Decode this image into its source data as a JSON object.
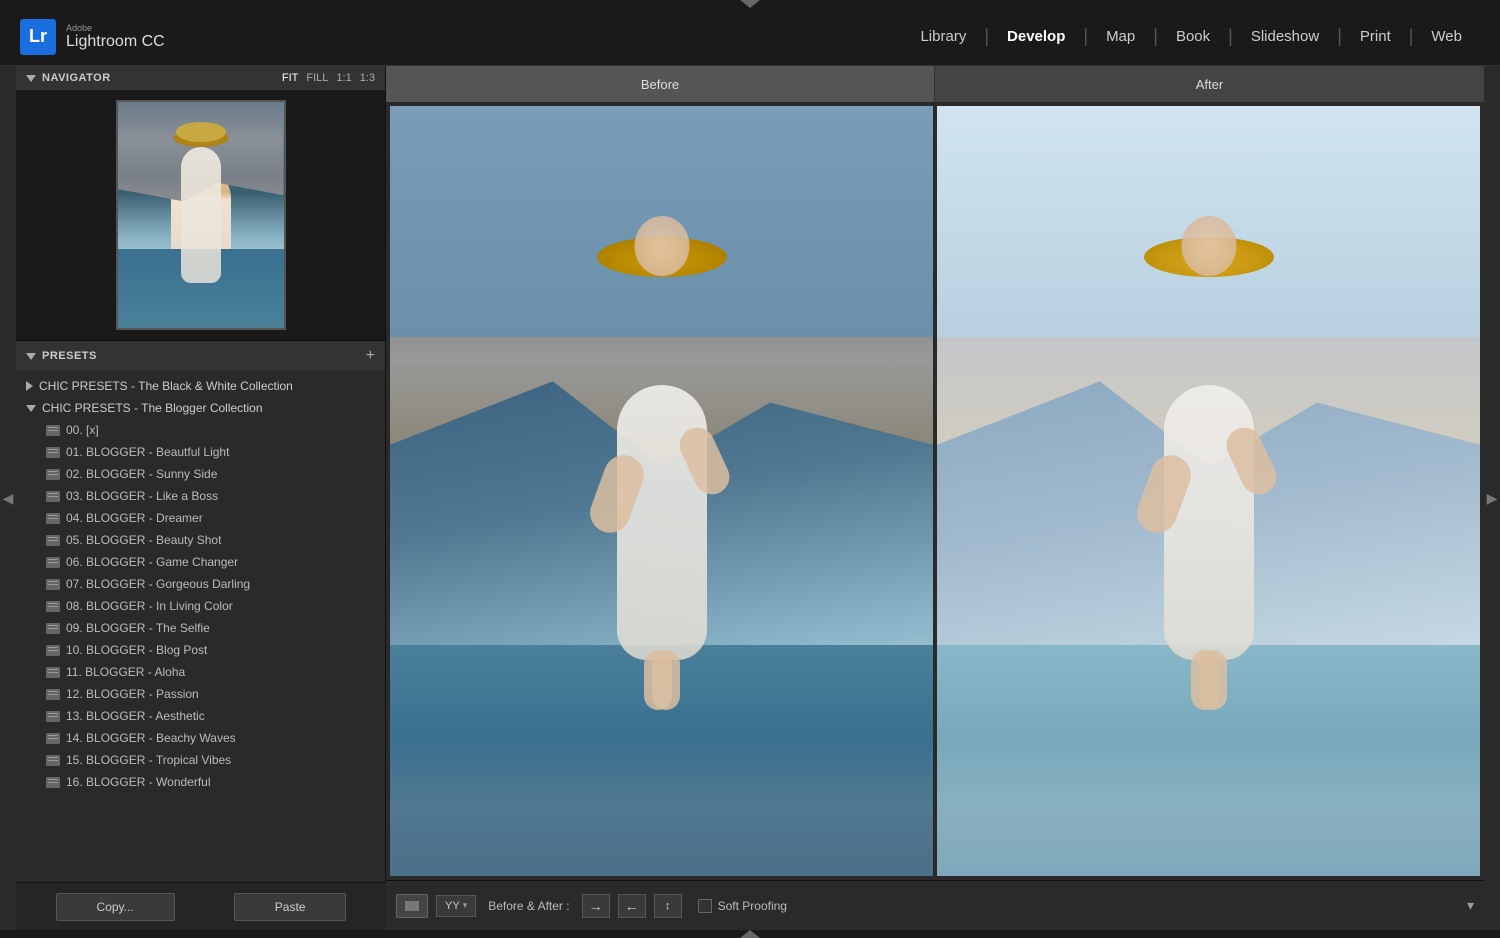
{
  "app": {
    "name": "Lightroom CC",
    "adobe_label": "Adobe",
    "lr_badge": "Lr"
  },
  "nav": {
    "items": [
      {
        "label": "Library",
        "active": false
      },
      {
        "label": "Develop",
        "active": true
      },
      {
        "label": "Map",
        "active": false
      },
      {
        "label": "Book",
        "active": false
      },
      {
        "label": "Slideshow",
        "active": false
      },
      {
        "label": "Print",
        "active": false
      },
      {
        "label": "Web",
        "active": false
      }
    ]
  },
  "navigator": {
    "title": "Navigator",
    "zoom_fit": "FIT",
    "zoom_fill": "FILL",
    "zoom_1_1": "1:1",
    "zoom_1_3": "1:3"
  },
  "presets": {
    "title": "Presets",
    "add_label": "+",
    "groups": [
      {
        "name": "CHIC PRESETS - The Black & White Collection",
        "expanded": false,
        "items": []
      },
      {
        "name": "CHIC PRESETS - The Blogger Collection",
        "expanded": true,
        "items": [
          "00. [x]",
          "01. BLOGGER - Beautful Light",
          "02. BLOGGER - Sunny Side",
          "03. BLOGGER - Like a Boss",
          "04. BLOGGER - Dreamer",
          "05. BLOGGER - Beauty Shot",
          "06. BLOGGER - Game Changer",
          "07. BLOGGER - Gorgeous Darling",
          "08. BLOGGER - In Living Color",
          "09. BLOGGER - The Selfie",
          "10. BLOGGER - Blog Post",
          "11. BLOGGER - Aloha",
          "12. BLOGGER - Passion",
          "13. BLOGGER - Aesthetic",
          "14. BLOGGER - Beachy Waves",
          "15. BLOGGER - Tropical Vibes",
          "16. BLOGGER - Wonderful"
        ]
      }
    ]
  },
  "before_after": {
    "before_label": "Before",
    "after_label": "After",
    "toolbar_before_after": "Before & After :"
  },
  "toolbar": {
    "copy_label": "Copy...",
    "paste_label": "Paste",
    "soft_proofing_label": "Soft Proofing"
  },
  "bottom_bar": {
    "show_bottom": "▲"
  }
}
